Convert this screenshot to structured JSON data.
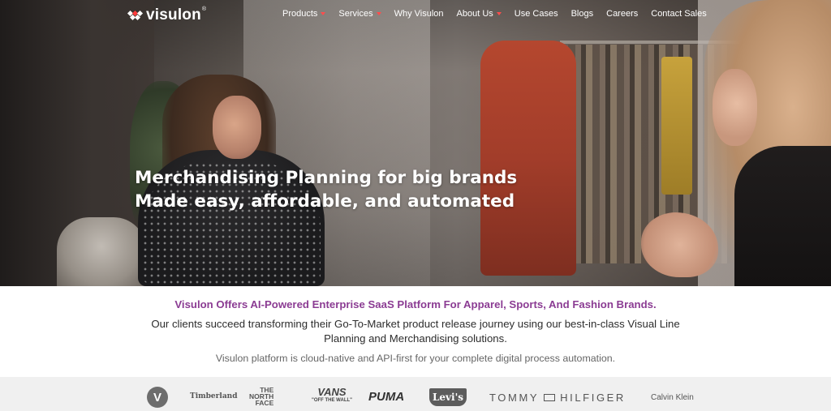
{
  "brand": {
    "name": "visulon",
    "trademark": "®"
  },
  "nav": {
    "items": [
      {
        "label": "Products",
        "dropdown": true
      },
      {
        "label": "Services",
        "dropdown": true
      },
      {
        "label": "Why Visulon",
        "dropdown": false
      },
      {
        "label": "About Us",
        "dropdown": true
      },
      {
        "label": "Use Cases",
        "dropdown": false
      },
      {
        "label": "Blogs",
        "dropdown": false
      },
      {
        "label": "Careers",
        "dropdown": false
      },
      {
        "label": "Contact Sales",
        "dropdown": false
      }
    ]
  },
  "hero": {
    "headline_line1": "Merchandising Planning for big brands",
    "headline_line2": "Made easy, affordable, and automated"
  },
  "intro": {
    "tagline": "Visulon Offers AI-Powered Enterprise SaaS Platform For Apparel, Sports, And Fashion Brands.",
    "description": "Our clients succeed transforming their Go-To-Market product release journey using our best-in-class Visual Line Planning and Merchandising solutions.",
    "subtext": "Visulon platform is cloud-native and API-first for your complete digital process automation."
  },
  "brands": {
    "v_logo": "V",
    "timberland": "Timberland",
    "tnf_line1": "THE",
    "tnf_line2": "NORTH",
    "tnf_line3": "FACE",
    "vans": "VANS",
    "vans_tag": "\"OFF THE WALL\"",
    "puma": "PUMA",
    "levis": "Levi's",
    "tommy_left": "TOMMY",
    "tommy_right": "HILFIGER",
    "calvin_klein": "Calvin Klein"
  },
  "colors": {
    "accent_purple": "#8b3c93",
    "dropdown_chevron": "#ff4d4d",
    "brand_strip_bg": "#f0f0f0"
  }
}
